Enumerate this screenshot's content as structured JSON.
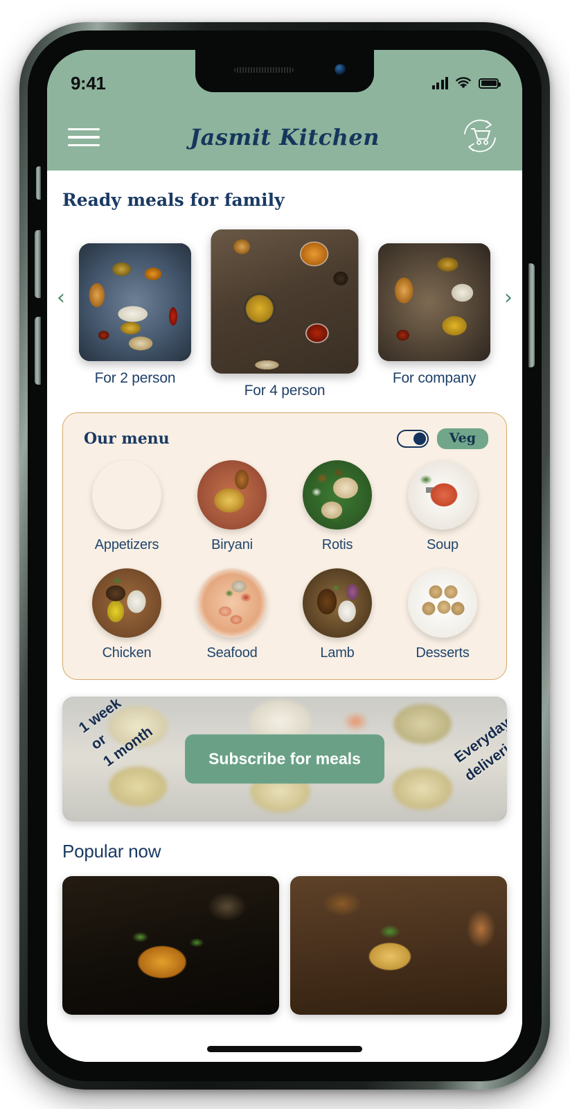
{
  "status_bar": {
    "time": "9:41",
    "signal_icon": "cellular-signal-icon",
    "wifi_icon": "wifi-icon",
    "battery_icon": "battery-full-icon"
  },
  "header": {
    "menu_icon": "hamburger-menu-icon",
    "brand_title": "Jasmit Kitchen",
    "cart_icon": "subscription-cart-icon",
    "background_color": "#8EB49D",
    "title_color": "#15365C"
  },
  "ready_meals": {
    "title": "Ready meals for family",
    "prev_arrow": "‹",
    "next_arrow": "›",
    "items": [
      {
        "label": "For 2 person",
        "image": "indian-thali-two-plate"
      },
      {
        "label": "For 4 person",
        "image": "indian-curry-spread-four"
      },
      {
        "label": "For company",
        "image": "samosa-rice-curry-platter"
      }
    ]
  },
  "our_menu": {
    "title": "Our menu",
    "toggle_state": "on",
    "veg_badge": "Veg",
    "veg_badge_color": "#71A68A",
    "card_background": "#F9EFE4",
    "card_border": "#D7A764",
    "categories": [
      {
        "label": "Appetizers",
        "image": "samosa-platter"
      },
      {
        "label": "Biryani",
        "image": "chicken-biryani-bowl"
      },
      {
        "label": "Rotis",
        "image": "roti-thali-banana-leaf"
      },
      {
        "label": "Soup",
        "image": "tomato-soup-bowl"
      },
      {
        "label": "Chicken",
        "image": "chicken-rice-bowl"
      },
      {
        "label": "Seafood",
        "image": "seafood-curry-bowl"
      },
      {
        "label": "Lamb",
        "image": "lamb-curry-rice-bowl"
      },
      {
        "label": "Desserts",
        "image": "laddu-dessert-plate"
      }
    ]
  },
  "subscribe_banner": {
    "tag_left": "1 week\nor\n1 month",
    "tag_right": "Everyday\ndeliveries",
    "button_label": "Subscribe for meals",
    "button_color": "#6AA186",
    "background_image": "blurred-meal-prep-trays"
  },
  "popular_now": {
    "title": "Popular now",
    "items": [
      {
        "image": "gobi-manchurian-skillet"
      },
      {
        "image": "paneer-curry-karahi"
      }
    ]
  },
  "device": {
    "home_indicator": "home-indicator-bar",
    "buttons": [
      "mute-switch",
      "volume-up",
      "volume-down",
      "power"
    ]
  }
}
